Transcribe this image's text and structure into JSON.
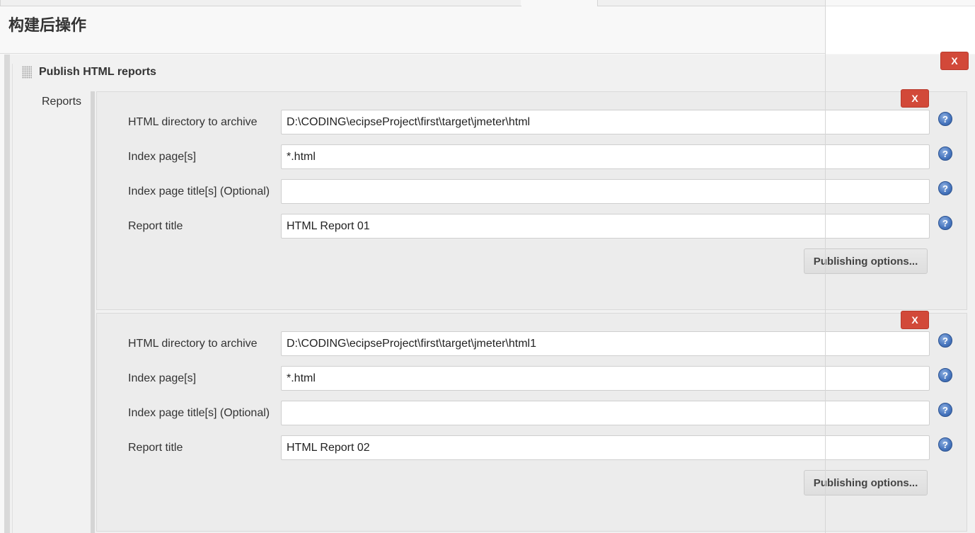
{
  "section": {
    "title": "构建后操作"
  },
  "publisher": {
    "title": "Publish HTML reports",
    "reports_label": "Reports",
    "delete_label": "X"
  },
  "labels": {
    "dir": "HTML directory to archive",
    "index": "Index page[s]",
    "index_title": "Index page title[s] (Optional)",
    "report_title": "Report title",
    "publishing_options": "Publishing options...",
    "delete": "X",
    "help": "?"
  },
  "reports": [
    {
      "dir": "D:\\CODING\\ecipseProject\\first\\target\\jmeter\\html",
      "index": "*.html",
      "index_title": "",
      "report_title": "HTML Report 01"
    },
    {
      "dir": "D:\\CODING\\ecipseProject\\first\\target\\jmeter\\html1",
      "index": "*.html",
      "index_title": "",
      "report_title": "HTML Report 02"
    }
  ]
}
